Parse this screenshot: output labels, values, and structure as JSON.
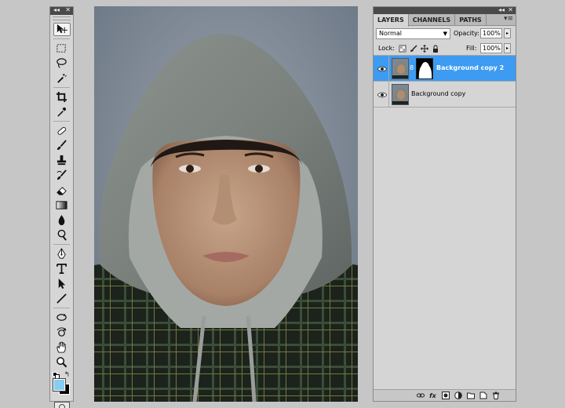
{
  "tools_panel": {
    "collapse_glyph": "◂◂",
    "close_glyph": "✕",
    "tools": [
      {
        "name": "move-tool",
        "icon": "move-icon",
        "active": true
      },
      {
        "name": "marquee-tool",
        "icon": "rect-marquee-icon"
      },
      {
        "name": "lasso-tool",
        "icon": "lasso-icon"
      },
      {
        "name": "magic-wand-tool",
        "icon": "magic-wand-icon"
      },
      {
        "name": "crop-tool",
        "icon": "crop-icon"
      },
      {
        "name": "eyedropper-tool",
        "icon": "eyedropper-icon"
      },
      {
        "name": "healing-brush-tool",
        "icon": "bandage-icon"
      },
      {
        "name": "brush-tool",
        "icon": "brush-icon"
      },
      {
        "name": "clone-stamp-tool",
        "icon": "stamp-icon"
      },
      {
        "name": "history-brush-tool",
        "icon": "history-brush-icon"
      },
      {
        "name": "eraser-tool",
        "icon": "eraser-icon"
      },
      {
        "name": "gradient-tool",
        "icon": "gradient-icon"
      },
      {
        "name": "blur-tool",
        "icon": "blur-drop-icon"
      },
      {
        "name": "dodge-tool",
        "icon": "dodge-icon"
      },
      {
        "name": "pen-tool",
        "icon": "pen-icon"
      },
      {
        "name": "type-tool",
        "icon": "type-icon"
      },
      {
        "name": "path-selection-tool",
        "icon": "arrow-icon"
      },
      {
        "name": "line-tool",
        "icon": "line-icon"
      },
      {
        "name": "3d-rotate-tool",
        "icon": "3d-rotate-icon"
      },
      {
        "name": "3d-orbit-tool",
        "icon": "3d-orbit-icon"
      },
      {
        "name": "hand-tool",
        "icon": "hand-icon"
      },
      {
        "name": "zoom-tool",
        "icon": "zoom-icon"
      }
    ],
    "colors": {
      "foreground": "#86cdf0",
      "background": "#000000"
    },
    "swap_glyph": "↰"
  },
  "layers_panel": {
    "collapse_glyph": "◂◂",
    "close_glyph": "✕",
    "tabs": [
      {
        "label": "LAYERS",
        "active": true
      },
      {
        "label": "CHANNELS",
        "active": false
      },
      {
        "label": "PATHS",
        "active": false
      }
    ],
    "menu_glyph": "▾≡",
    "blend_mode": "Normal",
    "opacity_label": "Opacity:",
    "opacity_value": "100%",
    "lock_label": "Lock:",
    "fill_label": "Fill:",
    "fill_value": "100%",
    "spin_glyph": "▸",
    "chain_glyph": "8",
    "selection_color": "#3d9bf2",
    "layers": [
      {
        "name": "Background copy 2",
        "selected": true,
        "has_mask": true,
        "visible": true
      },
      {
        "name": "Background copy",
        "selected": false,
        "has_mask": false,
        "visible": true
      }
    ],
    "footer_icons": [
      "link-icon",
      "fx-icon",
      "add-mask-icon",
      "adjustment-icon",
      "group-folder-icon",
      "new-layer-icon",
      "trash-icon"
    ],
    "fx_label": "fx"
  }
}
